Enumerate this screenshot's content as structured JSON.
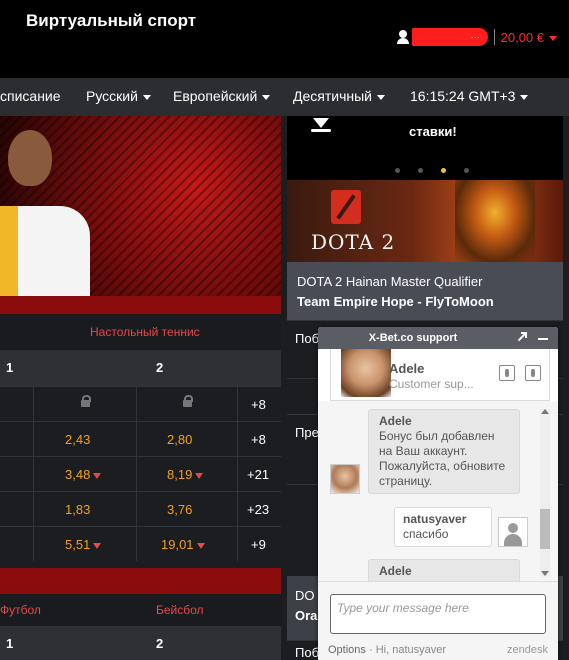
{
  "header": {
    "title": "Виртуальный спорт",
    "username_masked": "···",
    "balance": "20,00 €"
  },
  "nav": {
    "schedule": "списание",
    "language": "Русский",
    "region": "Европейский",
    "odds_format": "Десятичный",
    "time": "16:15:24 GMT+3"
  },
  "left_table": {
    "header_tab": "Настольный теннис",
    "col1": "1",
    "col2": "2",
    "rows": [
      {
        "v1": "",
        "v2": "",
        "more": "+8",
        "locked": true
      },
      {
        "v1": "2,43",
        "v2": "2,80",
        "more": "+8"
      },
      {
        "v1": "3,48",
        "v2": "8,19",
        "more": "+21"
      },
      {
        "v1": "1,83",
        "v2": "3,76",
        "more": "+23"
      },
      {
        "v1": "5,51",
        "v2": "19,01",
        "more": "+9"
      }
    ]
  },
  "left_table2": {
    "tab_left": "Футбол",
    "tab_right": "Бейсбол",
    "col1": "1",
    "col2": "2"
  },
  "right": {
    "promo_text": "ставки!",
    "banner_text": "DOTA 2",
    "match_title": "DOTA 2 Hainan Master Qualifier",
    "match_teams": "Team Empire Hope - FlyToMoon",
    "row_label_1": "Побе",
    "row_label_2": "Пре",
    "row_label_3": "DO",
    "row_label_4": "Ora",
    "row_label_5": "Поб"
  },
  "chat": {
    "title": "X-Bet.co support",
    "agent_name": "Adele",
    "agent_role": "Customer sup...",
    "messages": [
      {
        "who": "Adele",
        "text": "Бонус был добавлен на Ваш аккаунт. Пожалуйста, обновите страницу."
      },
      {
        "who": "natusyaver",
        "text": "спасибо"
      },
      {
        "who": "Adele",
        "text": ""
      }
    ],
    "input_placeholder": "Type your message here",
    "options_label": "Options",
    "greeting": "Hi, natusyaver",
    "brand": "zendesk"
  },
  "colors": {
    "accent_red": "#ff2b2b",
    "odds_orange": "#f0a020",
    "nav_bg": "#2c2d31"
  }
}
